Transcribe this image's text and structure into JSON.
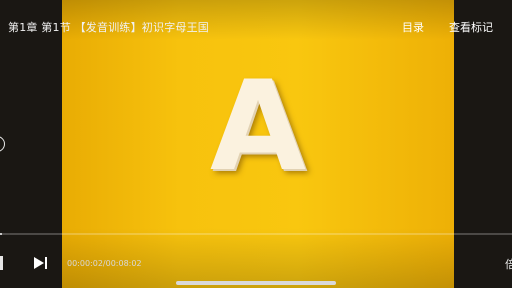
{
  "header": {
    "title": "第1章  第1节 【发音训练】初识字母王国",
    "menu_label": "目录",
    "marks_label": "查看标记"
  },
  "video": {
    "letter": "A",
    "background_color": "#f7c20d",
    "letter_color": "#fbf2df"
  },
  "controls": {
    "time": "00:00:02/00:08:02",
    "progress_fraction": 0.004,
    "speed_label": "倍",
    "icons": [
      "play-next-icon",
      "home-indicator"
    ]
  }
}
